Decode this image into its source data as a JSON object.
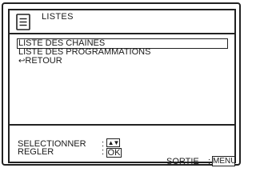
{
  "header": {
    "title": "LISTES",
    "icon": "list-icon"
  },
  "menu": {
    "items": [
      {
        "label": "LISTE DES CHAINES",
        "selected": true
      },
      {
        "label": "LISTE DES PROGRAMMATIONS",
        "selected": false
      },
      {
        "label": "RETOUR",
        "icon": "return-arrow-icon",
        "selected": false
      }
    ]
  },
  "footer": {
    "select_label": "SELECTIONNER",
    "adjust_label": "REGLER",
    "colon": ":",
    "select_key": "▲▼",
    "adjust_key": "OK",
    "exit_label": "SORTIE",
    "exit_key": "MENU"
  }
}
